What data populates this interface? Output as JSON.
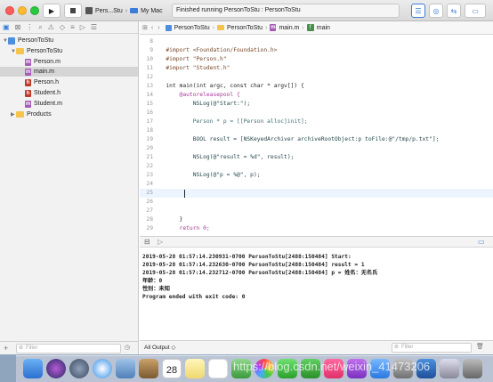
{
  "titlebar": {
    "scheme_target": "Pers...Stu",
    "scheme_device": "My Mac",
    "status_text": "Finished running PersonToStu : PersonToStu"
  },
  "navigator": {
    "items": [
      {
        "label": "PersonToStu",
        "kind": "project"
      },
      {
        "label": "PersonToStu",
        "kind": "folder"
      },
      {
        "label": "Person.m",
        "kind": "m"
      },
      {
        "label": "main.m",
        "kind": "m"
      },
      {
        "label": "Person.h",
        "kind": "h"
      },
      {
        "label": "Student.h",
        "kind": "h"
      },
      {
        "label": "Student.m",
        "kind": "m"
      },
      {
        "label": "Products",
        "kind": "folder"
      }
    ],
    "filter_placeholder": "Filter"
  },
  "jumpbar": {
    "crumbs": [
      "PersonToStu",
      "PersonToStu",
      "main.m",
      "main"
    ]
  },
  "editor": {
    "line_numbers": [
      "8",
      "9",
      "10",
      "11",
      "12",
      "13",
      "14",
      "15",
      "16",
      "17",
      "18",
      "19",
      "20",
      "21",
      "22",
      "23",
      "24",
      "25",
      "26",
      "27",
      "28",
      "29",
      "30",
      "31"
    ],
    "lines": {
      "l9": "#import <Foundation/Foundation.h>",
      "l10": "#import \"Person.h\"",
      "l11": "#import \"Student.h\"",
      "l13": "int main(int argc, const char * argv[]) {",
      "l14": "    @autoreleasepool {",
      "l15": "        NSLog(@\"Start:\");",
      "l17": "        Person * p = [[Person alloc]init];",
      "l19": "        BOOL result = [NSKeyedArchiver archiveRootObject:p toFile:@\"/tmp/p.txt\"];",
      "l21": "        NSLog(@\"result = %d\", result);",
      "l23": "        NSLog(@\"p = %@\", p);",
      "l28": "    }",
      "l29": "    return 0;",
      "l30": "}"
    }
  },
  "console": {
    "lines": [
      "2019-05-28 01:57:14.230931-0700 PersonToStu[2488:150484] Start:",
      "2019-05-28 01:57:14.232630-0700 PersonToStu[2488:150484] result = 1",
      "2019-05-28 01:57:14.232712-0700 PersonToStu[2488:150484] p = 姓名：无名氏",
      "年龄：0",
      "性别：未知",
      "Program ended with exit code: 0"
    ],
    "output_selector": "All Output ◇",
    "filter_placeholder": "Filter"
  },
  "dock": {
    "calendar_day": "28",
    "watermark": "https://blog.csdn.net/weixin_41473206"
  },
  "colors": {
    "accent": "#4a8fe0",
    "folder": "#f6c34b",
    "m_file": "#a45ab6",
    "h_file": "#c0392b"
  }
}
